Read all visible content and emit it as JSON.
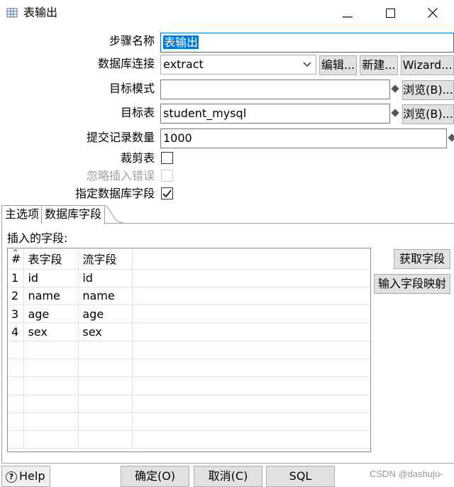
{
  "window": {
    "title": "表输出",
    "minimize_glyph": "—",
    "maximize_glyph": "☐",
    "close_glyph": "✕"
  },
  "form": {
    "step_name_label": "步骤名称",
    "step_name_value": "表输出",
    "db_connection_label": "数据库连接",
    "db_connection_value": "extract",
    "edit_button": "编辑...",
    "new_button": "新建...",
    "wizard_button": "Wizard...",
    "target_schema_label": "目标模式",
    "target_schema_value": "",
    "browse_button_1": "浏览(B)...",
    "target_table_label": "目标表",
    "target_table_value": "student_mysql",
    "browse_button_2": "浏览(B)...",
    "commit_size_label": "提交记录数量",
    "commit_size_value": "1000",
    "truncate_label": "裁剪表",
    "truncate_checked": false,
    "ignore_errors_label": "忽略插入错误",
    "ignore_errors_checked": false,
    "specify_fields_label": "指定数据库字段",
    "specify_fields_checked": true
  },
  "tabs": [
    {
      "label": "主选项"
    },
    {
      "label": "数据库字段"
    }
  ],
  "fields_panel": {
    "insert_fields_label": "插入的字段:",
    "columns": [
      "#",
      "表字段",
      "流字段"
    ],
    "rows": [
      {
        "num": "1",
        "table_field": "id",
        "stream_field": "id"
      },
      {
        "num": "2",
        "table_field": "name",
        "stream_field": "name"
      },
      {
        "num": "3",
        "table_field": "age",
        "stream_field": "age"
      },
      {
        "num": "4",
        "table_field": "sex",
        "stream_field": "sex"
      }
    ],
    "get_fields_button": "获取字段",
    "enter_mapping_button": "输入字段映射"
  },
  "bottom": {
    "help_button": "Help",
    "ok_button": "确定(O)",
    "cancel_button": "取消(C)",
    "sql_button": "SQL",
    "watermark": "CSDN @dashuju-"
  }
}
